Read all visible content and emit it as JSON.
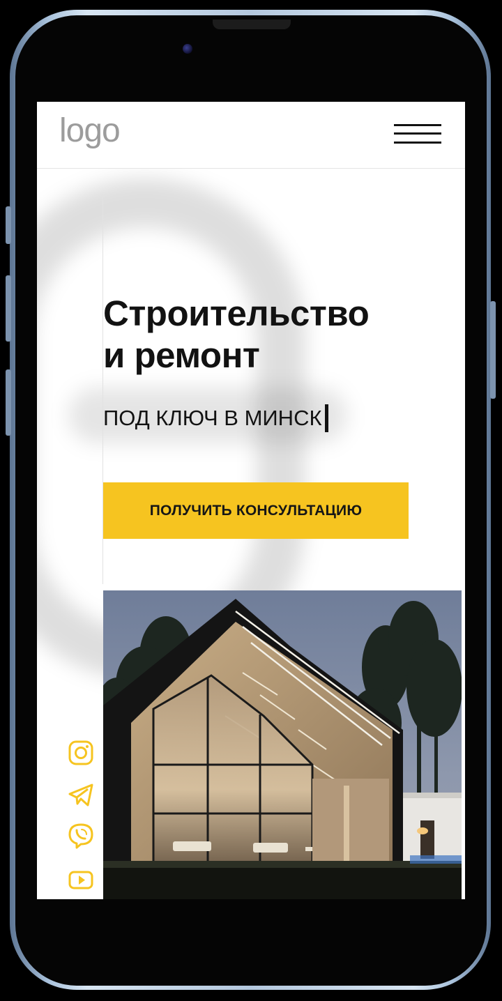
{
  "header": {
    "logo_text": "logo",
    "menu_icon": "hamburger-menu-icon"
  },
  "hero": {
    "title_line1": "Строительство",
    "title_line2": "и ремонт",
    "subtitle": "ПОД КЛЮЧ В МИНСК",
    "cta_label": "ПОЛУЧИТЬ КОНСУЛЬТАЦИЮ"
  },
  "social": [
    {
      "icon": "instagram-icon"
    },
    {
      "icon": "telegram-icon"
    },
    {
      "icon": "viber-icon"
    },
    {
      "icon": "youtube-icon"
    }
  ],
  "colors": {
    "accent": "#f6c420",
    "text": "#121212",
    "logo": "#9c9c9c"
  }
}
